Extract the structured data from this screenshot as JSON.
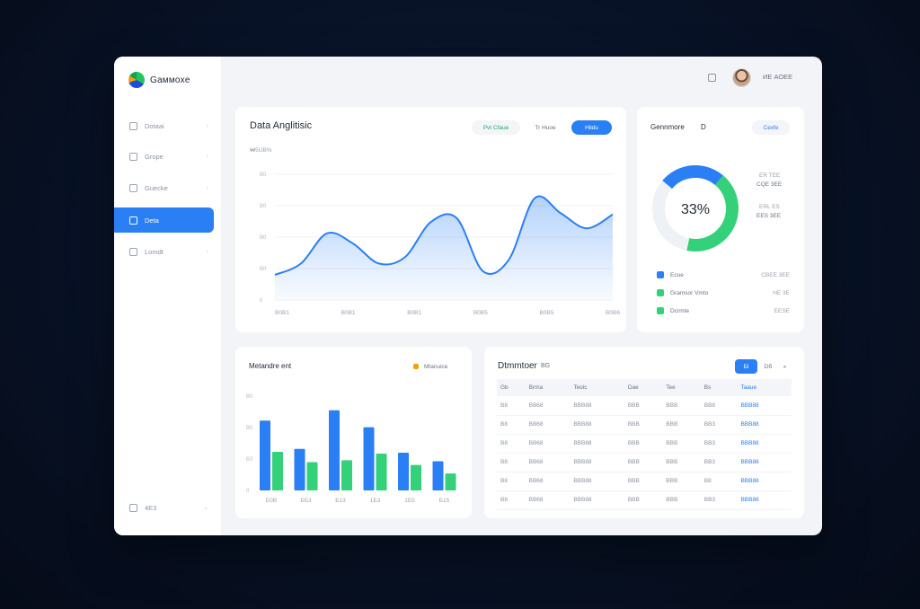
{
  "app": {
    "brand_name": "Gaммоxе"
  },
  "sidebar": {
    "items": [
      {
        "label": "Dotaai",
        "icon": "dashboard-icon",
        "active": false
      },
      {
        "label": "Grope",
        "icon": "grid-icon",
        "active": false
      },
      {
        "label": "Guecke",
        "icon": "box-icon",
        "active": false
      },
      {
        "label": "Deta",
        "icon": "folder-icon",
        "active": true
      },
      {
        "label": "Lomdt",
        "icon": "file-icon",
        "active": false
      }
    ],
    "footer": {
      "label": "4E3",
      "icon": "settings-icon"
    }
  },
  "topbar": {
    "user_name": "ИЕ АОЕЕ"
  },
  "area_card": {
    "title": "Data Anglitisic",
    "subtitle": "₩5UB%",
    "filters": [
      {
        "label": "Pvt  Cfaue",
        "active": false
      },
      {
        "label": "Tr  Huoe",
        "active": false
      },
      {
        "label": "Hlidu",
        "active": true
      }
    ]
  },
  "donut_card": {
    "title": "Gennmore",
    "title_suffix": "D",
    "action": "Cexfe",
    "percent_label": "33%",
    "side_stats": [
      {
        "label": "ER TEE",
        "value": "CQE 3EE"
      },
      {
        "label": "ERL ES",
        "value": "EES 3EE"
      }
    ],
    "legend": [
      {
        "label": "Ecue",
        "value": "CBEE 3EE",
        "color": "#2a7ff5"
      },
      {
        "label": "Gramsor Vmto",
        "value": "HE 3E",
        "color": "#34d17a"
      },
      {
        "label": "Dcrmte",
        "value": "EESE",
        "color": "#34d17a"
      }
    ]
  },
  "bar_card": {
    "title": "Metandre ent",
    "legend_label": "Mtanuice"
  },
  "table_card": {
    "title": "Dtmmtoer",
    "title_suffix": "BG",
    "toggle": {
      "active": "Бl",
      "inactive": "Dб",
      "more": "▸"
    },
    "columns": [
      "Gb",
      "Brma",
      "Teoic",
      "Dae",
      "Tee",
      "Bs",
      "Taaue"
    ],
    "rows": [
      [
        "B8",
        "BB68",
        "BBB88",
        "BBB",
        "BBB",
        "BB8",
        "BBB88"
      ],
      [
        "B8",
        "BB68",
        "BBB88",
        "BBB",
        "BBB",
        "BB3",
        "BBB88"
      ],
      [
        "B8",
        "BB68",
        "BBB88",
        "BBB",
        "BBB",
        "BB3",
        "BBB88"
      ],
      [
        "B8",
        "BB68",
        "BBB88",
        "BBB",
        "BBB",
        "BB3",
        "BBB88"
      ],
      [
        "B8",
        "BB68",
        "BBB88",
        "BBB",
        "BBB",
        "B8",
        "BBB88"
      ],
      [
        "B8",
        "BB68",
        "BBB88",
        "BBB",
        "BBB",
        "BB3",
        "BBB88"
      ]
    ]
  },
  "chart_data": [
    {
      "type": "area",
      "title": "Data Anglitisic",
      "x": [
        "B0B1",
        "B0B1",
        "B0B1",
        "B0B5",
        "B0B5",
        "B0B6"
      ],
      "series": [
        {
          "values": [
            20,
            29,
            53,
            45,
            29,
            34,
            62,
            65,
            23,
            32,
            81,
            69,
            57,
            68
          ]
        }
      ],
      "y_ticks": [
        "B0",
        "B0",
        "B0",
        "B0",
        "0"
      ],
      "ylim": [
        0,
        100
      ],
      "grid": true,
      "color": "#2a7ff5"
    },
    {
      "type": "pie",
      "title": "Gennmore",
      "values": [
        25,
        42,
        33
      ],
      "colors": [
        "#2a7ff5",
        "#34d17a",
        "#eef1f5"
      ],
      "center_label": "33%"
    },
    {
      "type": "bar",
      "title": "Metandre ent",
      "categories": [
        "Б0B",
        "ББ3",
        "Б13",
        "1Б3",
        "1Б5",
        "Б15"
      ],
      "series": [
        {
          "values": [
            74,
            44,
            85,
            67,
            40,
            31
          ],
          "color": "#2a7ff5"
        },
        {
          "values": [
            41,
            30,
            32,
            39,
            27,
            18
          ],
          "color": "#34d17a"
        }
      ],
      "y_ticks": [
        "B0",
        "B0",
        "Б0",
        "0"
      ],
      "ylim": [
        0,
        100
      ]
    }
  ]
}
